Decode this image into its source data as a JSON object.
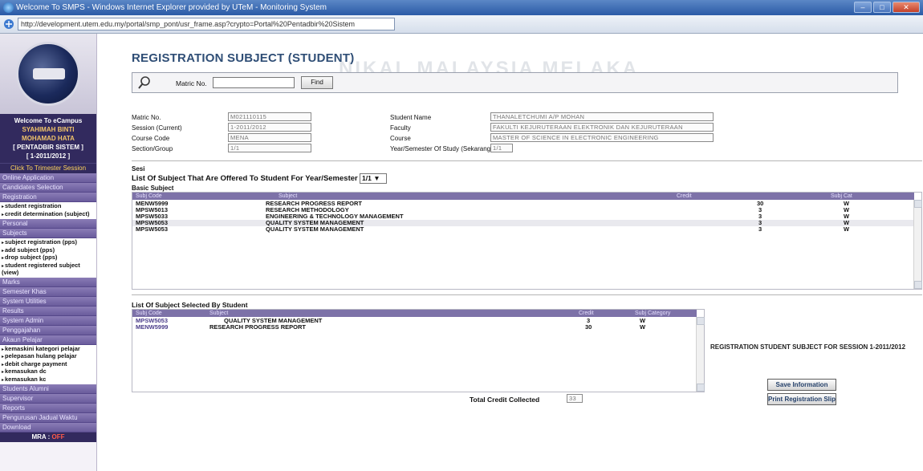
{
  "window": {
    "title": "Welcome To SMPS - Windows Internet Explorer provided by UTeM - Monitoring System",
    "url": "http://development.utem.edu.my/portal/smp_pont/usr_frame.asp?crypto=Portal%20Pentadbir%20Sistem",
    "watermark": "NIKAL MALAYSIA MELAKA"
  },
  "sidebar": {
    "welcome": "Welcome To eCampus",
    "user_name_1": "SYAHIMAH BINTI",
    "user_name_2": "MOHAMAD HATA",
    "role": "[ PENTADBIR SISTEM ]",
    "session": "[ 1-2011/2012 ]",
    "click_session": "Click To Trimester Session",
    "menu_top": [
      "Online Application",
      "Candidates Selection",
      "Registration"
    ],
    "registration_sub": [
      "student registration",
      "credit determination (subject)"
    ],
    "menu_mid": [
      "Personal",
      "Subjects"
    ],
    "subjects_sub": [
      "subject registration (pps)",
      "add subject (pps)",
      "drop subject (pps)",
      "student registered subject (view)"
    ],
    "menu_mid2": [
      "Marks",
      "Semester Khas",
      "System Utilities",
      "Results",
      "System Admin",
      "Penggajahan",
      "Akaun Pelajar"
    ],
    "akaun_sub": [
      "kemaskini kategori pelajar",
      "pelepasan hulang pelajar",
      "debit charge payment",
      "kemasukan dc",
      "kemasukan kc"
    ],
    "menu_bottom": [
      "Students Alumni",
      "Supervisor",
      "Reports",
      "Pengurusan Jadual Waktu",
      "Download"
    ],
    "mra_label": "MRA : ",
    "mra_value": "OFF"
  },
  "main": {
    "title": "REGISTRATION SUBJECT (STUDENT)",
    "search": {
      "label": "Matric No.",
      "value": "",
      "button": "Find"
    },
    "info": {
      "matric_label": "Matric No.",
      "matric_value": "M021110115",
      "session_label": "Session (Current)",
      "session_value": "1-2011/2012",
      "course_code_label": "Course Code",
      "course_code_value": "MENA",
      "section_label": "Section/Group",
      "section_value": "1/1",
      "student_name_label": "Student Name",
      "student_name_value": "THANALETCHUMI A/P MOHAN",
      "faculty_label": "Faculty",
      "faculty_value": "FAKULTI KEJURUTERAAN ELEKTRONIK DAN KEJURUTERAAN",
      "course_label": "Course",
      "course_value": "MASTER OF SCIENCE IN ELECTRONIC ENGINEERING",
      "year_label": "Year/Semester Of Study (Sekarang)",
      "year_value": "1/1"
    },
    "sesi_label": "Sesi",
    "offered_title": "List Of Subject That Are Offered To Student For Year/Semester",
    "offered_select": "1/1",
    "basic_subject_label": "Basic Subject",
    "offered_headers": [
      "Subj Code",
      "Subject",
      "Credit",
      "Subj Cat"
    ],
    "offered_rows": [
      {
        "code": "MENW5999",
        "subject": "RESEARCH PROGRESS REPORT",
        "credit": "30",
        "cat": "W"
      },
      {
        "code": "MPSW5013",
        "subject": "RESEARCH METHODOLOGY",
        "credit": "3",
        "cat": "W"
      },
      {
        "code": "MPSW5033",
        "subject": "ENGINEERING & TECHNOLOGY MANAGEMENT",
        "credit": "3",
        "cat": "W"
      },
      {
        "code": "MPSW5053",
        "subject": "QUALITY SYSTEM MANAGEMENT",
        "credit": "3",
        "cat": "W"
      },
      {
        "code": "MPSW5053",
        "subject": "QUALITY SYSTEM MANAGEMENT",
        "credit": "3",
        "cat": "W"
      }
    ],
    "selected_title": "List Of Subject Selected By Student",
    "selected_headers": [
      "Subj Code",
      "Subject",
      "Credit",
      "Subj Category"
    ],
    "selected_rows": [
      {
        "code": "MPSW5053",
        "subject": "QUALITY SYSTEM MANAGEMENT",
        "credit": "3",
        "cat": "W"
      },
      {
        "code": "MENW5999",
        "subject": "RESEARCH PROGRESS REPORT",
        "credit": "30",
        "cat": "W"
      }
    ],
    "registration_note": "REGISTRATION STUDENT SUBJECT FOR SESSION 1-2011/2012",
    "save_button": "Save Information",
    "print_button": "Print Registration Slip",
    "total_credit_label": "Total Credit Collected",
    "total_credit_value": "33"
  },
  "colors": {
    "sidebar_dark": "#322a5e",
    "sidebar_menu": "#7a6cab",
    "table_header": "#7d72a8",
    "title_blue": "#2f4e76"
  }
}
